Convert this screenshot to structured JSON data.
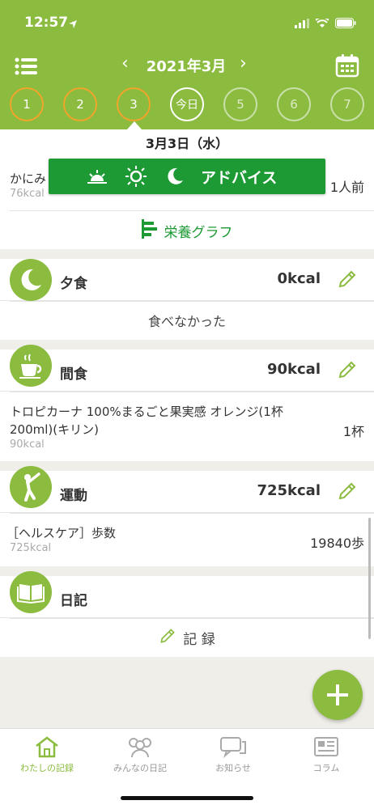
{
  "status": {
    "time": "12:57"
  },
  "nav": {
    "month": "2021年3月",
    "prev": "‹",
    "next": "›"
  },
  "days": [
    {
      "label": "1",
      "state": "done"
    },
    {
      "label": "2",
      "state": "done"
    },
    {
      "label": "3",
      "state": "selected"
    },
    {
      "label": "今日",
      "state": "today"
    },
    {
      "label": "5",
      "state": "future"
    },
    {
      "label": "6",
      "state": "future"
    },
    {
      "label": "7",
      "state": "future"
    }
  ],
  "date_label": "3月3日（水）",
  "advice": {
    "label": "アドバイス"
  },
  "lunch_item": {
    "name": "かにみ",
    "kcal": "76kcal",
    "qty": "1人前"
  },
  "nutrition_graph": {
    "label": "栄養グラフ"
  },
  "dinner": {
    "title": "夕食",
    "kcal": "0kcal",
    "note": "食べなかった"
  },
  "snack": {
    "title": "間食",
    "kcal": "90kcal",
    "item_name_line1": "トロピカーナ 100%まるごと果実感 オレンジ(1杯",
    "item_name_line2": "200ml)(キリン)",
    "item_kcal": "90kcal",
    "item_qty": "1杯"
  },
  "exercise": {
    "title": "運動",
    "kcal": "725kcal",
    "item_name": "［ヘルスケア］歩数",
    "item_kcal": "725kcal",
    "item_qty": "19840歩"
  },
  "diary": {
    "title": "日記",
    "record_label": "記 録"
  },
  "tabs": [
    {
      "label": "わたしの記録",
      "icon": "home-icon",
      "active": true
    },
    {
      "label": "みんなの日記",
      "icon": "people-icon",
      "active": false
    },
    {
      "label": "お知らせ",
      "icon": "chat-icon",
      "active": false
    },
    {
      "label": "コラム",
      "icon": "newspaper-icon",
      "active": false
    }
  ],
  "colors": {
    "brand": "#8bbb3f",
    "advice": "#1e9a35",
    "ring_done": "#f0a52b"
  }
}
